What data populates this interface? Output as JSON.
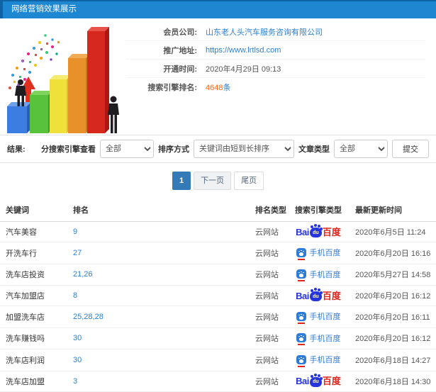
{
  "header": {
    "title": "网络营销效果展示"
  },
  "info": {
    "rows": [
      {
        "label": "会员公司:",
        "value": "山东老人头汽车服务咨询有限公司"
      },
      {
        "label": "推广地址:",
        "value": "https://www.lrtlsd.com"
      },
      {
        "label": "开通时间:",
        "value": "2020年4月29日 09:13"
      },
      {
        "label": "搜索引擎排名:",
        "value": "4648",
        "suffix": "条"
      }
    ]
  },
  "filters": {
    "result_label": "结果:",
    "engine_label": "分搜索引擎查看",
    "engine_value": "全部",
    "sort_label": "排序方式",
    "sort_value": "关键词由短到长排序",
    "article_label": "文章类型",
    "article_value": "全部",
    "submit_label": "提交"
  },
  "pagination": {
    "current": "1",
    "next_label": "下一页",
    "last_label": "尾页"
  },
  "logos": {
    "baidu": {
      "bai": "Bai",
      "du": "du",
      "cn": "百度"
    },
    "mobile_baidu": "手机百度"
  },
  "table": {
    "headers": [
      "关键词",
      "排名",
      "排名类型",
      "搜索引擎类型",
      "最新更新时间"
    ],
    "rows": [
      {
        "keyword": "汽车美容",
        "rank": "9",
        "rank_type": "云网站",
        "engine": "baidu",
        "updated": "2020年6月5日 11:24"
      },
      {
        "keyword": "开洗车行",
        "rank": "27",
        "rank_type": "云网站",
        "engine": "mobile-baidu",
        "updated": "2020年6月20日 16:16"
      },
      {
        "keyword": "洗车店投资",
        "rank": "21,26",
        "rank_type": "云网站",
        "engine": "mobile-baidu",
        "updated": "2020年5月27日 14:58"
      },
      {
        "keyword": "汽车加盟店",
        "rank": "8",
        "rank_type": "云网站",
        "engine": "baidu",
        "updated": "2020年6月20日 16:12"
      },
      {
        "keyword": "加盟洗车店",
        "rank": "25,28,28",
        "rank_type": "云网站",
        "engine": "mobile-baidu",
        "updated": "2020年6月20日 16:11"
      },
      {
        "keyword": "洗车赚钱吗",
        "rank": "30",
        "rank_type": "云网站",
        "engine": "mobile-baidu",
        "updated": "2020年6月20日 16:12"
      },
      {
        "keyword": "洗车店利润",
        "rank": "30",
        "rank_type": "云网站",
        "engine": "mobile-baidu",
        "updated": "2020年6月18日 14:27"
      },
      {
        "keyword": "洗车店加盟",
        "rank": "3",
        "rank_type": "云网站",
        "engine": "baidu",
        "updated": "2020年6月18日 14:30"
      }
    ]
  },
  "colors": {
    "header_bg": "#1e87d2",
    "link_blue": "#2a7fd0",
    "accent_orange": "#ff6600",
    "active_page_bg": "#337ab7",
    "baidu_blue": "#2534dc",
    "baidu_red": "#e1251b"
  }
}
